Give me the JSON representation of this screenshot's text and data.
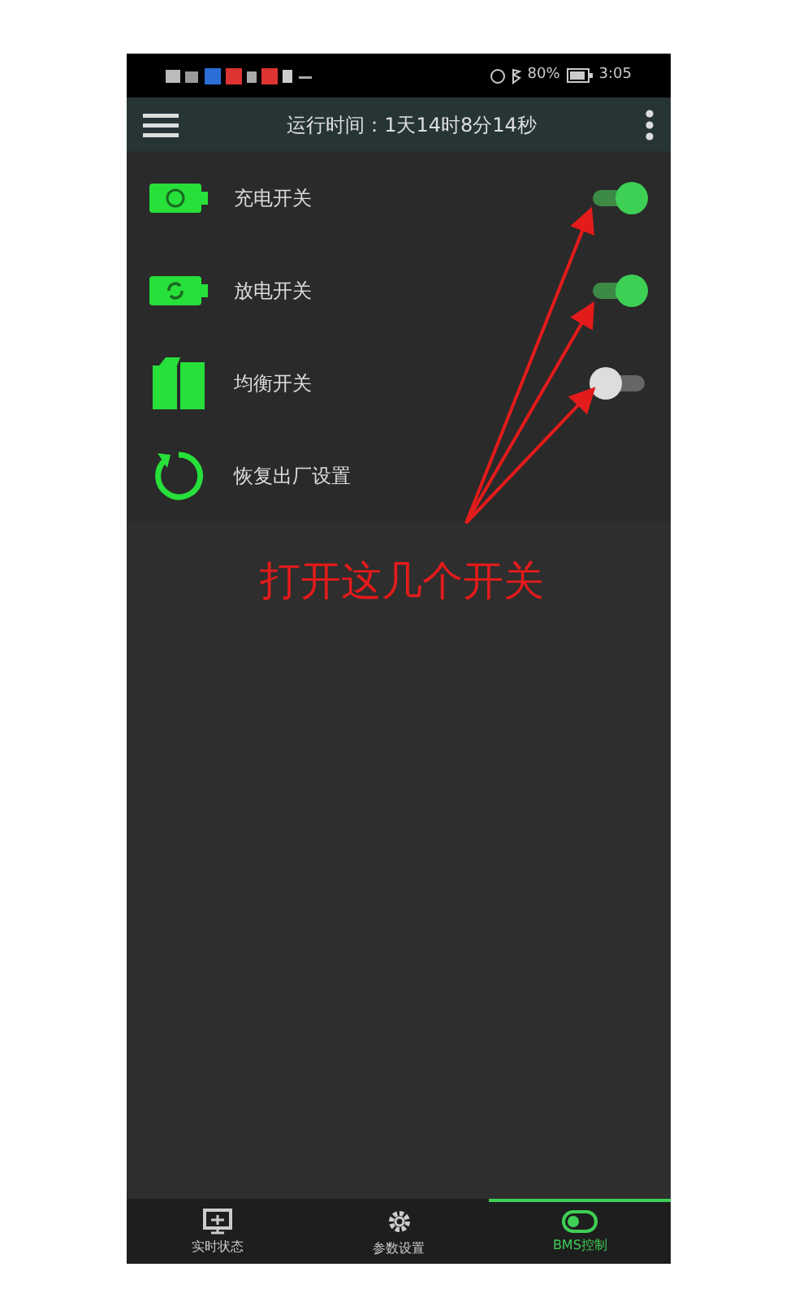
{
  "status_bar": {
    "battery": "80%",
    "time": "3:05"
  },
  "header": {
    "title": "运行时间：1天14时8分14秒"
  },
  "settings": [
    {
      "kind": "toggle",
      "label": "充电开关",
      "on": true
    },
    {
      "kind": "toggle",
      "label": "放电开关",
      "on": true
    },
    {
      "kind": "toggle",
      "label": "均衡开关",
      "on": false
    },
    {
      "kind": "action",
      "label": "恢复出厂设置"
    }
  ],
  "annotation": {
    "text": "打开这几个开关"
  },
  "bottom_nav": [
    {
      "label": "实时状态",
      "selected": false
    },
    {
      "label": "参数设置",
      "selected": false
    },
    {
      "label": "BMS控制",
      "selected": true
    }
  ]
}
